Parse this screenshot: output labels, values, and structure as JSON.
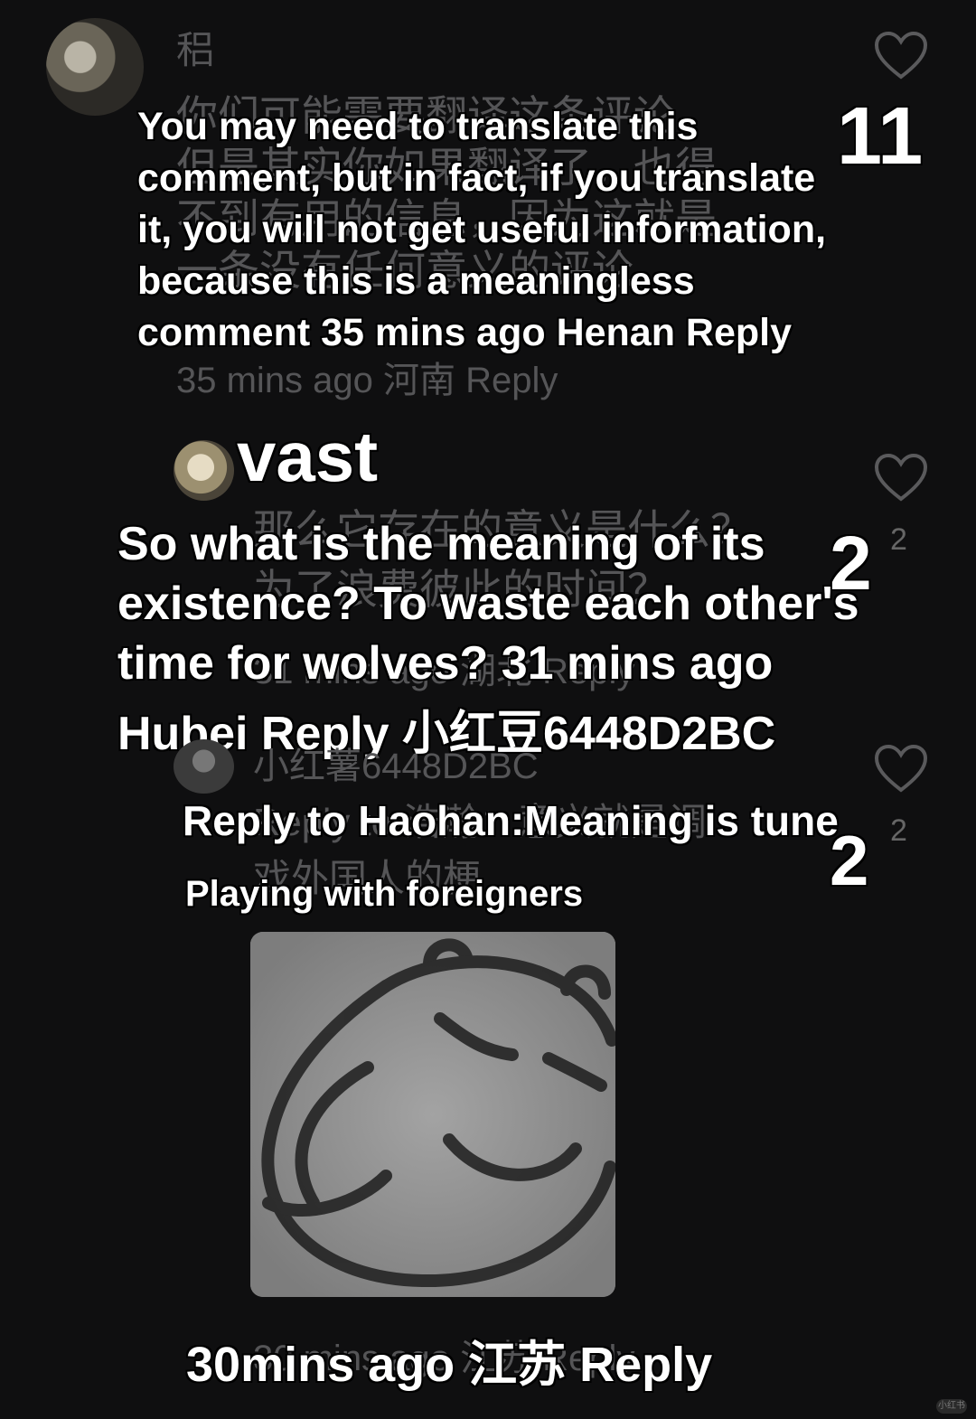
{
  "comment1": {
    "username_faint": "稆",
    "body_faint_lines": [
      "你们可能需要翻译这条评论，",
      "但是其实你如果翻译了，也得",
      "不到有用的信息，因为这就是",
      "一条没有任何意义的评论"
    ],
    "meta_faint": "35 mins ago 河南 Reply",
    "overlay_lines": [
      "You may need to translate this",
      "comment, but in fact, if you translate",
      "it, you will not get useful information,",
      "because this is a meaningless",
      "comment 35 mins ago Henan Reply"
    ],
    "likes": "11"
  },
  "comment2": {
    "username_overlay": "vast",
    "body_faint_lines": [
      "那么它存在的意义是什么？",
      "为了浪费彼此的时间？"
    ],
    "meta_faint": "31 mins ago 湖北 Reply",
    "likes_faint": "2",
    "overlay_lines": [
      "So what is the meaning of its",
      "existence? To waste each other's",
      "time for wolves? 31 mins ago",
      "Hubei Reply 小红豆6448D2BC"
    ],
    "likes": "2"
  },
  "comment3": {
    "username_faint": "小红薯6448D2BC",
    "body_faint_lines": [
      "Reply to 浩瀚：意义就是调",
      "戏外国人的梗"
    ],
    "likes_faint": "2",
    "overlay_line1": "Reply to Haohan:Meaning is tune",
    "overlay_line2": "Playing with foreigners",
    "likes": "2",
    "meta_faint": "30 mins ago 江苏 Reply",
    "meta_overlay": "30mins ago 江苏 Reply"
  },
  "watermark": "小红书",
  "icons": [
    "heart-icon",
    "heart-icon",
    "heart-icon"
  ]
}
